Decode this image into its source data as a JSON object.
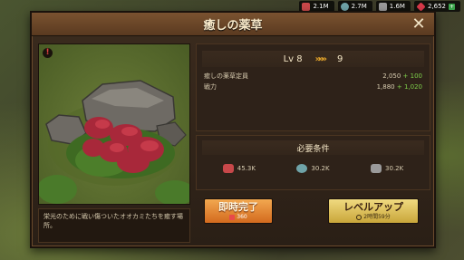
{
  "resources": [
    {
      "icon": "meat-icon",
      "value": "2.1M",
      "color": "#c8484a"
    },
    {
      "icon": "ore-icon",
      "value": "2.7M",
      "color": "#6fa3a8"
    },
    {
      "icon": "stone-icon",
      "value": "1.6M",
      "color": "#9a9a9a"
    },
    {
      "icon": "gem-icon",
      "value": "2,652",
      "color": "#d83a4a"
    }
  ],
  "dialog": {
    "title": "癒しの薬草",
    "description": "栄光のために戦い傷ついたオオカミたちを癒す場所。"
  },
  "level": {
    "current": "Lv 8",
    "next": "9",
    "arrow": "»»»"
  },
  "stats": [
    {
      "label": "癒しの薬草定員",
      "value": "2,050",
      "plus": "+ 100"
    },
    {
      "label": "戦力",
      "value": "1,880",
      "plus": "+ 1,020"
    }
  ],
  "requirements": {
    "title": "必要条件",
    "items": [
      {
        "icon": "meat-icon",
        "value": "45.3K",
        "color": "#c8484a"
      },
      {
        "icon": "ore-icon",
        "value": "30.2K",
        "color": "#6fa3a8"
      },
      {
        "icon": "stone-icon",
        "value": "30.2K",
        "color": "#9a9a9a"
      }
    ]
  },
  "buttons": {
    "instant": {
      "label": "即時完了",
      "cost": "360"
    },
    "upgrade": {
      "label": "レベルアップ",
      "time": "2時間59分"
    }
  }
}
